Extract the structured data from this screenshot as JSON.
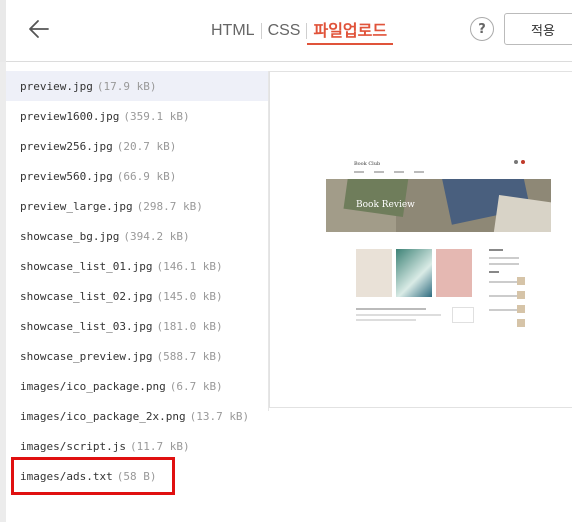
{
  "header": {
    "tabs": [
      {
        "label": "HTML",
        "active": false
      },
      {
        "label": "CSS",
        "active": false
      },
      {
        "label": "파일업로드",
        "active": true
      }
    ],
    "help_label": "?",
    "apply_label": "적용",
    "back_icon": "arrow-left-icon"
  },
  "files": [
    {
      "name": "preview.jpg",
      "size": "(17.9 kB)",
      "selected": true
    },
    {
      "name": "preview1600.jpg",
      "size": "(359.1 kB)"
    },
    {
      "name": "preview256.jpg",
      "size": "(20.7 kB)"
    },
    {
      "name": "preview560.jpg",
      "size": "(66.9 kB)"
    },
    {
      "name": "preview_large.jpg",
      "size": "(298.7 kB)"
    },
    {
      "name": "showcase_bg.jpg",
      "size": "(394.2 kB)"
    },
    {
      "name": "showcase_list_01.jpg",
      "size": "(146.1 kB)"
    },
    {
      "name": "showcase_list_02.jpg",
      "size": "(145.0 kB)"
    },
    {
      "name": "showcase_list_03.jpg",
      "size": "(181.0 kB)"
    },
    {
      "name": "showcase_preview.jpg",
      "size": "(588.7 kB)"
    },
    {
      "name": "images/ico_package.png",
      "size": "(6.7 kB)"
    },
    {
      "name": "images/ico_package_2x.png",
      "size": "(13.7 kB)"
    },
    {
      "name": "images/script.js",
      "size": "(11.7 kB)"
    },
    {
      "name": "images/ads.txt",
      "size": "(58 B)",
      "highlighted": true
    }
  ],
  "preview": {
    "site_logo": "Book Club",
    "hero_title": "Book Review"
  },
  "colors": {
    "accent": "#e0533a",
    "highlight": "#e01010",
    "selected_row": "#eef0f8"
  }
}
